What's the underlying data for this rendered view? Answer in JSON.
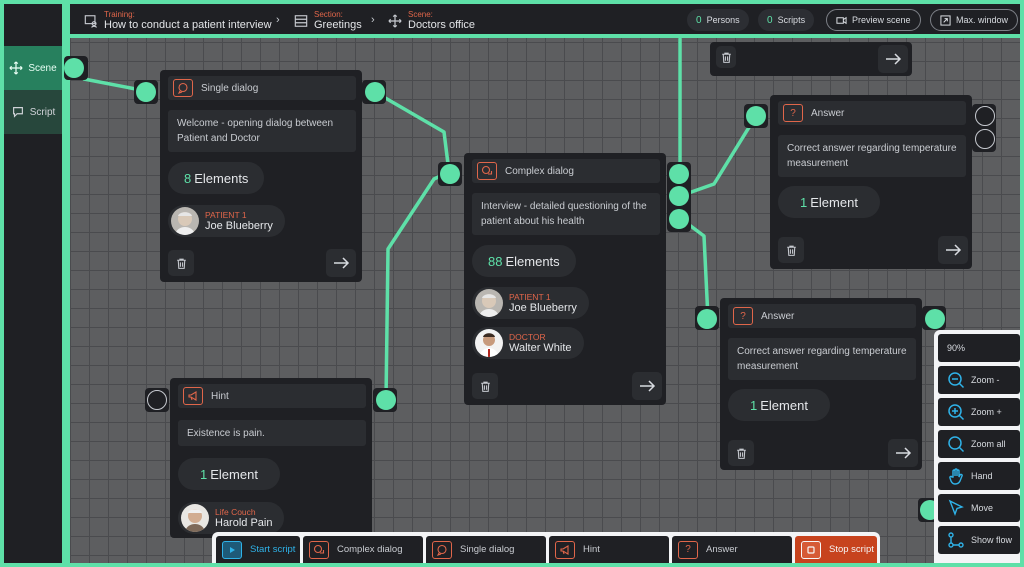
{
  "sidebar": {
    "items": [
      {
        "label": "Scene",
        "icon": "move-arrows-icon",
        "active": true
      },
      {
        "label": "Script",
        "icon": "chat-bubble-icon",
        "active": false
      }
    ]
  },
  "header": {
    "training": {
      "label": "Training:",
      "value": "How to conduct a patient interview"
    },
    "section": {
      "label": "Section:",
      "value": "Greetings"
    },
    "scene": {
      "label": "Scene:",
      "value": "Doctors office"
    },
    "persons": {
      "count": "0",
      "label": "Persons"
    },
    "scripts": {
      "count": "0",
      "label": "Scripts"
    },
    "preview": "Preview scene",
    "max_window": "Max. window"
  },
  "nodes": {
    "single_dialog": {
      "title": "Single dialog",
      "description": "Welcome - opening dialog between Patient and Doctor",
      "count": "8",
      "count_label": "Elements",
      "persons": [
        {
          "role": "PATIENT 1",
          "name": "Joe Blueberry"
        }
      ]
    },
    "complex_dialog": {
      "title": "Complex dialog",
      "description": "Interview - detailed questioning of the patient about his health",
      "count": "88",
      "count_label": "Elements",
      "persons": [
        {
          "role": "PATIENT 1",
          "name": "Joe Blueberry"
        },
        {
          "role": "DOCTOR",
          "name": "Walter White"
        }
      ]
    },
    "answer_1": {
      "title": "Answer",
      "description": "Correct answer regarding temperature measurement",
      "count": "1",
      "count_label": "Element"
    },
    "answer_2": {
      "title": "Answer",
      "description": "Correct answer regarding temperature measurement",
      "count": "1",
      "count_label": "Element"
    },
    "hint": {
      "title": "Hint",
      "description": "Existence is pain.",
      "count": "1",
      "count_label": "Element",
      "persons": [
        {
          "role": "Life Couch",
          "name": "Harold Pain"
        }
      ]
    }
  },
  "tools": {
    "zoom_level": "90%",
    "items": [
      {
        "label": "Zoom -",
        "icon": "zoom-out-icon"
      },
      {
        "label": "Zoom +",
        "icon": "zoom-in-icon"
      },
      {
        "label": "Zoom all",
        "icon": "zoom-all-icon"
      },
      {
        "label": "Hand",
        "icon": "hand-icon"
      },
      {
        "label": "Move",
        "icon": "cursor-icon"
      },
      {
        "label": "Show flow",
        "icon": "flow-icon"
      }
    ]
  },
  "bottombar": {
    "items": [
      {
        "label": "Start script",
        "icon": "play-icon"
      },
      {
        "label": "Complex dialog",
        "icon": "chat-bubbles-icon"
      },
      {
        "label": "Single dialog",
        "icon": "chat-bubble-icon"
      },
      {
        "label": "Hint",
        "icon": "megaphone-icon"
      },
      {
        "label": "Answer",
        "icon": "question-icon"
      },
      {
        "label": "Stop script",
        "icon": "stop-icon"
      }
    ]
  },
  "colors": {
    "accent": "#5ee0a8",
    "node_bg": "#1f2024",
    "canvas_bg": "#5d5e60",
    "orange": "#e0664a",
    "blue": "#2fb2e8",
    "stop": "#c7431e"
  }
}
